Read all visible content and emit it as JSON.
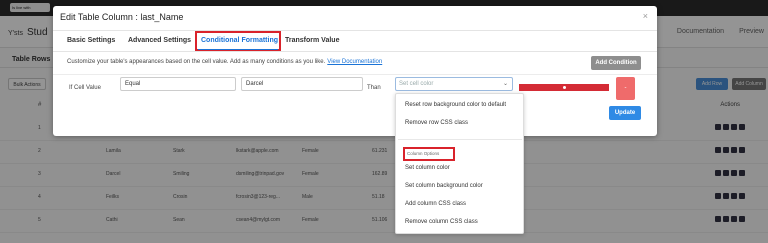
{
  "background": {
    "notice": "Is live with",
    "brand_prefix": "Y'sts",
    "brand": "Stud",
    "documentation": "Documentation",
    "preview": "Preview",
    "tab_rows": "Table Rows",
    "bulk_actions": "Bulk Actions",
    "add_row": "Add Row",
    "add_column": "Add Column",
    "hash_header": "#",
    "actions_header": "Actions",
    "rows": [
      {
        "id": "1",
        "first": "",
        "last": "",
        "email": "",
        "gender": "",
        "ip": "",
        "extra": ""
      },
      {
        "id": "2",
        "first": "Lamila",
        "last": "Stark",
        "email": "lkstark@apple.com",
        "gender": "Female",
        "ip": "61.231",
        "extra": ""
      },
      {
        "id": "3",
        "first": "Darcel",
        "last": "Smiling",
        "email": "dsmiling@trinpad.gov",
        "gender": "Female",
        "ip": "162.89",
        "extra": ""
      },
      {
        "id": "4",
        "first": "Feilks",
        "last": "Crosin",
        "email": "fcrosin3@123-reg...",
        "gender": "Male",
        "ip": "51.18",
        "extra": ""
      },
      {
        "id": "5",
        "first": "Cathi",
        "last": "Sean",
        "email": "csean4@mylgt.com",
        "gender": "Female",
        "ip": "51.106",
        "extra": ""
      }
    ]
  },
  "modal": {
    "title": "Edit Table Column : last_Name",
    "close": "×",
    "tabs": [
      "Basic Settings",
      "Advanced Settings",
      "Conditional Formatting",
      "Transform Value"
    ],
    "description": "Customize your table's appearances based on the cell value. Add as many conditions as you like.",
    "doc_link": "View Documentation",
    "add_condition": "Add Condition",
    "if_label": "If Cell Value",
    "operator": "Equal",
    "value": "Darcel",
    "than_label": "Than",
    "action_placeholder": "Set cell color",
    "delete_icon": "-",
    "update": "Update"
  },
  "dropdown": {
    "row_items": [
      "Reset row background color to default",
      "Remove row CSS class"
    ],
    "group_label": "Column Options",
    "column_items": [
      "Set column color",
      "Set column background color",
      "Add column CSS class",
      "Remove column CSS class"
    ]
  },
  "colors": {
    "accent": "#1a73d6",
    "highlight": "#d9232b",
    "update_button": "#2f8ae5",
    "delete_button": "#ef6b6b"
  }
}
